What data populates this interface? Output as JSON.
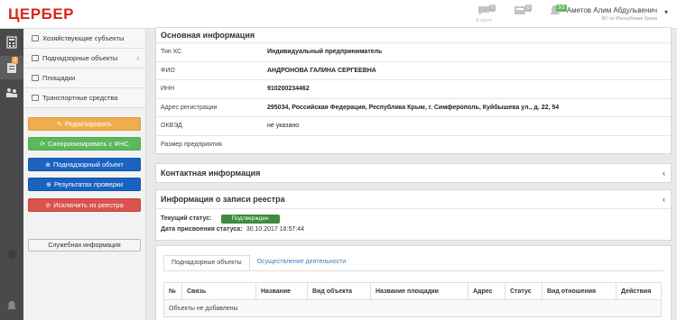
{
  "app": {
    "logo": "ЦЕРБЕР"
  },
  "topbar": {
    "icons": [
      {
        "name": "chat-icon",
        "badge": "0",
        "caption": "В групп"
      },
      {
        "name": "inbox-icon",
        "badge": "0"
      },
      {
        "name": "bell-icon",
        "badge": "3/3"
      }
    ],
    "user": {
      "name": "Аметов Алим Абдульвенич",
      "org": "ВУ по Республике Крым"
    }
  },
  "strip": {
    "badge": "2"
  },
  "sidebar": {
    "items": [
      {
        "label": "Хозяйствующие субъекты"
      },
      {
        "label": "Поднадзорные объекты"
      },
      {
        "label": "Площадки"
      },
      {
        "label": "Транспортные средства"
      }
    ],
    "buttons": {
      "edit": "Редактировать",
      "sync": "Синхронизировать с ФНС",
      "object": "Поднадзорный объект",
      "results": "Результатах проверки",
      "exclude": "Исключить из реестра"
    },
    "service": "Служебная информация"
  },
  "main": {
    "basic": {
      "title": "Основная информация",
      "rows": [
        {
          "key": "Тип ХС",
          "value": "Индивидуальный предприниматель"
        },
        {
          "key": "ФИО",
          "value": "АНДРОНОВА ГАЛИНА СЕРГЕЕВНА"
        },
        {
          "key": "ИНН",
          "value": "910200234462"
        },
        {
          "key": "Адрес регистрации",
          "value": "295034, Российская Федерация, Республика Крым, г. Симферополь, Куйбышева ул., д. 22, 54"
        },
        {
          "key": "ОКВЭД",
          "value": "не указано"
        },
        {
          "key": "Размер предприятия",
          "value": ""
        }
      ]
    },
    "contact": {
      "title": "Контактная информация"
    },
    "registry": {
      "title": "Информация о записи реестра",
      "status_label": "Текущий статус:",
      "status_value": "Подтвержден",
      "date_label": "Дата присвоения статуса:",
      "date_value": "30.10.2017 16:57:44"
    },
    "tabs": [
      {
        "label": "Поднадзорные объекты"
      },
      {
        "label": "Осуществление деятельности"
      }
    ],
    "grid": {
      "columns": [
        "№",
        "Связь",
        "Название",
        "Вид объекта",
        "Название площадки",
        "Адрес",
        "Статус",
        "Вид отношения",
        "Действия"
      ],
      "empty": "Объекты не добавлены"
    }
  }
}
